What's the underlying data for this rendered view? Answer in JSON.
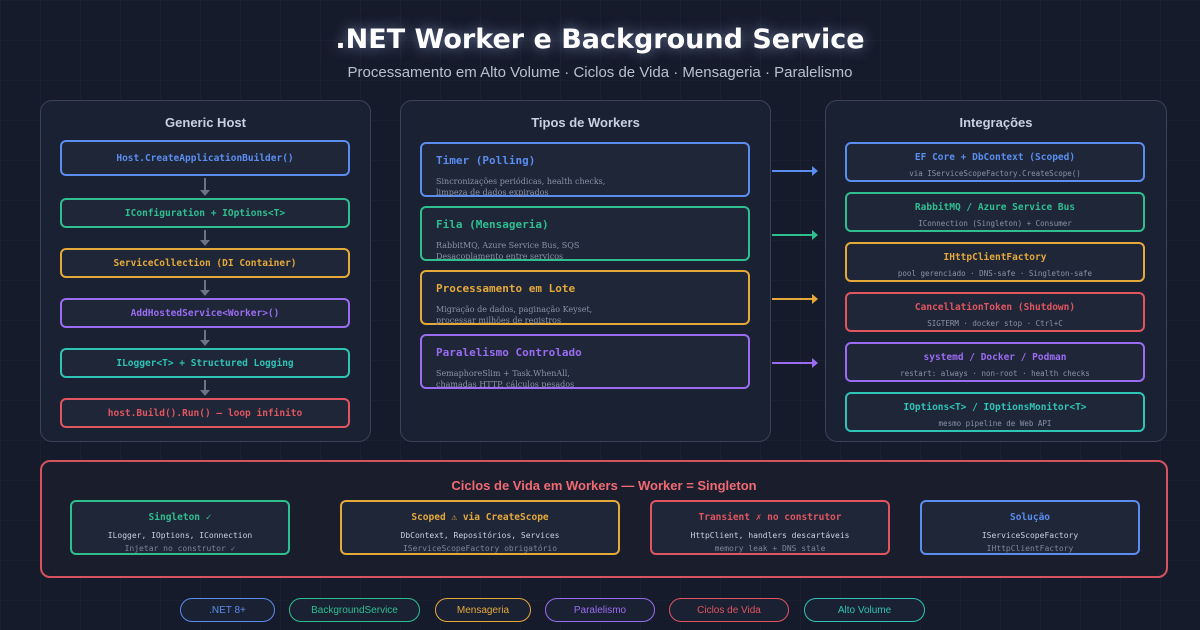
{
  "header": {
    "title": ".NET Worker e Background Service",
    "subtitle": "Processamento em Alto Volume · Ciclos de Vida · Mensageria · Paralelismo"
  },
  "host": {
    "title": "Generic Host",
    "steps": [
      {
        "label": "Host.CreateApplicationBuilder()",
        "color": "#5b8def"
      },
      {
        "label": "IConfiguration + IOptions<T>",
        "color": "#2fbf8f"
      },
      {
        "label": "ServiceCollection (DI Container)",
        "color": "#e5a93a"
      },
      {
        "label": "AddHostedService<Worker>()",
        "color": "#9b6cf2"
      },
      {
        "label": "ILogger<T> + Structured Logging",
        "color": "#2ec4b6"
      },
      {
        "label": "host.Build().Run() — loop infinito",
        "color": "#e0555f"
      }
    ]
  },
  "workers": {
    "title": "Tipos de Workers",
    "items": [
      {
        "title": "Timer (Polling)",
        "line1": "Sincronizações periódicas, health checks,",
        "line2": "limpeza de dados expirados",
        "color": "#5b8def"
      },
      {
        "title": "Fila (Mensageria)",
        "line1": "RabbitMQ, Azure Service Bus, SQS",
        "line2": "Desacoplamento entre serviços",
        "color": "#2fbf8f"
      },
      {
        "title": "Processamento em Lote",
        "line1": "Migração de dados, paginação Keyset,",
        "line2": "processar milhões de registros",
        "color": "#e5a93a"
      },
      {
        "title": "Paralelismo Controlado",
        "line1": "SemaphoreSlim + Task.WhenAll,",
        "line2": "chamadas HTTP, cálculos pesados",
        "color": "#9b6cf2"
      }
    ]
  },
  "integrations": {
    "title": "Integrações",
    "items": [
      {
        "title": "EF Core + DbContext (Scoped)",
        "sub": "via IServiceScopeFactory.CreateScope()",
        "color": "#5b8def"
      },
      {
        "title": "RabbitMQ / Azure Service Bus",
        "sub": "IConnection (Singleton) + Consumer",
        "color": "#2fbf8f"
      },
      {
        "title": "IHttpClientFactory",
        "sub": "pool gerenciado · DNS-safe · Singleton-safe",
        "color": "#e5a93a"
      },
      {
        "title": "CancellationToken (Shutdown)",
        "sub": "SIGTERM · docker stop · Ctrl+C",
        "color": "#e0555f"
      },
      {
        "title": "systemd / Docker / Podman",
        "sub": "restart: always · non-root · health checks",
        "color": "#9b6cf2"
      },
      {
        "title": "IOptions<T> / IOptionsMonitor<T>",
        "sub": "mesmo pipeline de Web API",
        "color": "#2ec4b6"
      }
    ]
  },
  "lifecycle": {
    "title": "Ciclos de Vida em Workers — Worker = Singleton",
    "items": [
      {
        "title": "Singleton ✓",
        "line1": "ILogger, IOptions, IConnection",
        "line2": "Injetar no construtor ✓",
        "color": "#2fbf8f"
      },
      {
        "title": "Scoped ⚠ via CreateScope",
        "line1": "DbContext, Repositórios, Services",
        "line2": "IServiceScopeFactory obrigatório",
        "color": "#e5a93a"
      },
      {
        "title": "Transient ✗ no construtor",
        "line1": "HttpClient, handlers descartáveis",
        "line2": "memory leak + DNS stale",
        "color": "#e0555f"
      },
      {
        "title": "Solução",
        "line1": "IServiceScopeFactory",
        "line2": "IHttpClientFactory",
        "color": "#5b8def"
      }
    ]
  },
  "tags": [
    {
      "label": ".NET 8+",
      "color": "#5b8def"
    },
    {
      "label": "BackgroundService",
      "color": "#2fbf8f"
    },
    {
      "label": "Mensageria",
      "color": "#e5a93a"
    },
    {
      "label": "Paralelismo",
      "color": "#9b6cf2"
    },
    {
      "label": "Ciclos de Vida",
      "color": "#e0555f"
    },
    {
      "label": "Alto Volume",
      "color": "#2ec4b6"
    }
  ]
}
